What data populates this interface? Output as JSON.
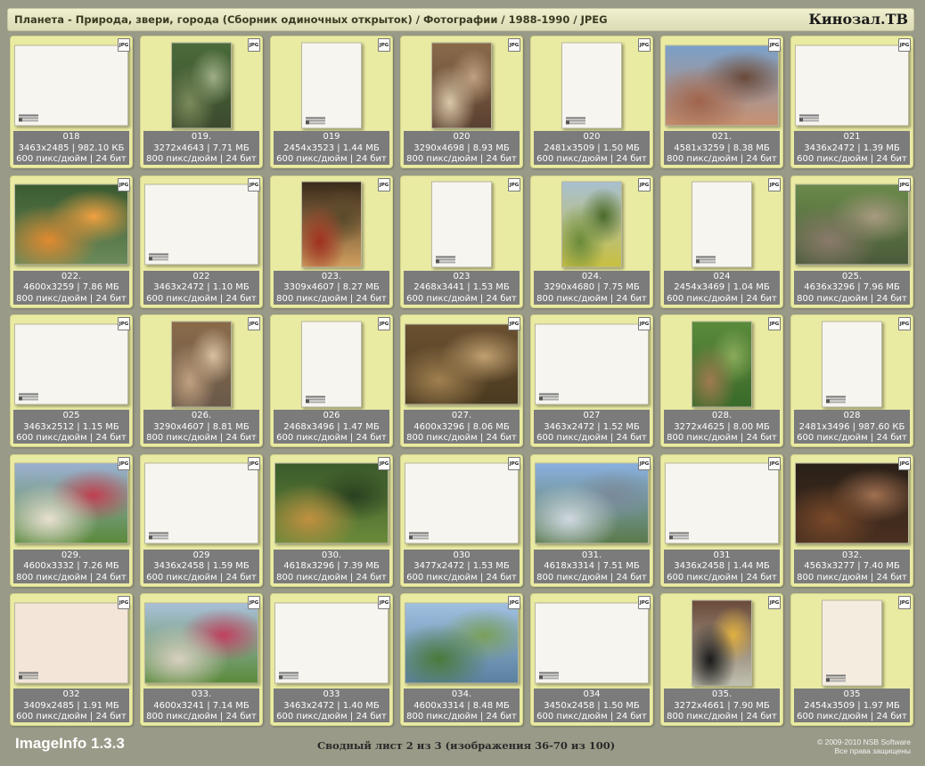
{
  "header": {
    "title": "Планета - Природа, звери, города (Сборник одиночных открыток) / Фотографии / 1988-1990 / JPEG",
    "brand": "Кинозал.ТВ"
  },
  "badge_label": "JPG",
  "cells": [
    {
      "name": "018",
      "dims": "3463x2485 | 982.10 КБ",
      "meta": "600 пикс/дюйм | 24 бит",
      "kind": "back-land"
    },
    {
      "name": "019.",
      "dims": "3272x4643 | 7.71 МБ",
      "meta": "800 пикс/дюйм | 24 бит",
      "kind": "photo-port",
      "palette": [
        "#4a6b3a",
        "#7a8a5a",
        "#3c4a2e",
        "#9fae86"
      ]
    },
    {
      "name": "019",
      "dims": "2454x3523 | 1.44 МБ",
      "meta": "600 пикс/дюйм | 24 бит",
      "kind": "back-port"
    },
    {
      "name": "020",
      "dims": "3290x4698 | 8.93 МБ",
      "meta": "800 пикс/дюйм | 24 бит",
      "kind": "photo-port",
      "palette": [
        "#8a6a4a",
        "#d9c7a8",
        "#5a4030",
        "#c0a080"
      ]
    },
    {
      "name": "020",
      "dims": "2481x3509 | 1.50 МБ",
      "meta": "600 пикс/дюйм | 24 бит",
      "kind": "back-port"
    },
    {
      "name": "021.",
      "dims": "4581x3259 | 8.38 МБ",
      "meta": "800 пикс/дюйм | 24 бит",
      "kind": "photo-land",
      "palette": [
        "#7aa0c8",
        "#a0644a",
        "#c89070",
        "#6a4a3a"
      ]
    },
    {
      "name": "021",
      "dims": "3436x2472 | 1.39 МБ",
      "meta": "600 пикс/дюйм | 24 бит",
      "kind": "back-land"
    },
    {
      "name": "022.",
      "dims": "4600x3259 | 7.86 МБ",
      "meta": "800 пикс/дюйм | 24 бит",
      "kind": "photo-land",
      "palette": [
        "#3a5a30",
        "#e08a30",
        "#6a8a5a",
        "#f0a040"
      ]
    },
    {
      "name": "022",
      "dims": "3463x2472 | 1.10 МБ",
      "meta": "600 пикс/дюйм | 24 бит",
      "kind": "back-land"
    },
    {
      "name": "023.",
      "dims": "3309x4607 | 8.27 МБ",
      "meta": "800 пикс/дюйм | 24 бит",
      "kind": "photo-port",
      "palette": [
        "#3a2a1a",
        "#a03020",
        "#d0a060",
        "#5a4a2a"
      ]
    },
    {
      "name": "023",
      "dims": "2468x3441 | 1.53 МБ",
      "meta": "600 пикс/дюйм | 24 бит",
      "kind": "back-port"
    },
    {
      "name": "024.",
      "dims": "3290x4680 | 7.75 МБ",
      "meta": "800 пикс/дюйм | 24 бит",
      "kind": "photo-port",
      "palette": [
        "#a8c0d0",
        "#6a8a3a",
        "#c8c040",
        "#4a6a2a"
      ]
    },
    {
      "name": "024",
      "dims": "2454x3469 | 1.04 МБ",
      "meta": "600 пикс/дюйм | 24 бит",
      "kind": "back-port"
    },
    {
      "name": "025.",
      "dims": "4636x3296 | 7.96 МБ",
      "meta": "800 пикс/дюйм | 24 бит",
      "kind": "photo-land",
      "palette": [
        "#6a8a4a",
        "#8a7a6a",
        "#4a5a3a",
        "#a89a80"
      ]
    },
    {
      "name": "025",
      "dims": "3463x2512 | 1.15 МБ",
      "meta": "600 пикс/дюйм | 24 бит",
      "kind": "back-land"
    },
    {
      "name": "026.",
      "dims": "3290x4607 | 8.81 МБ",
      "meta": "800 пикс/дюйм | 24 бит",
      "kind": "photo-port",
      "palette": [
        "#8a6a4a",
        "#c0a080",
        "#6a5a4a",
        "#d8c0a0"
      ]
    },
    {
      "name": "026",
      "dims": "2468x3496 | 1.47 МБ",
      "meta": "600 пикс/дюйм | 24 бит",
      "kind": "back-port"
    },
    {
      "name": "027.",
      "dims": "4600x3296 | 8.06 МБ",
      "meta": "800 пикс/дюйм | 24 бит",
      "kind": "photo-land",
      "palette": [
        "#6a5030",
        "#a08050",
        "#4a3a20",
        "#c0a070"
      ]
    },
    {
      "name": "027",
      "dims": "3463x2472 | 1.52 МБ",
      "meta": "600 пикс/дюйм | 24 бит",
      "kind": "back-land"
    },
    {
      "name": "028.",
      "dims": "3272x4625 | 8.00 МБ",
      "meta": "800 пикс/дюйм | 24 бит",
      "kind": "photo-port",
      "palette": [
        "#5a8a3a",
        "#a07a50",
        "#3a6a2a",
        "#8aaa5a"
      ]
    },
    {
      "name": "028",
      "dims": "2481x3496 | 987.60 КБ",
      "meta": "600 пикс/дюйм | 24 бит",
      "kind": "back-port"
    },
    {
      "name": "029.",
      "dims": "4600x3332 | 7.26 МБ",
      "meta": "800 пикс/дюйм | 24 бит",
      "kind": "photo-land",
      "palette": [
        "#9ab0d0",
        "#e8e0d0",
        "#5a8a3a",
        "#c04050"
      ]
    },
    {
      "name": "029",
      "dims": "3436x2458 | 1.59 МБ",
      "meta": "600 пикс/дюйм | 24 бит",
      "kind": "back-land"
    },
    {
      "name": "030.",
      "dims": "4618x3296 | 7.39 МБ",
      "meta": "800 пикс/дюйм | 24 бит",
      "kind": "photo-land",
      "palette": [
        "#3a5a2a",
        "#c09040",
        "#6a8a3a",
        "#2a4020"
      ]
    },
    {
      "name": "030",
      "dims": "3477x2472 | 1.53 МБ",
      "meta": "600 пикс/дюйм | 24 бит",
      "kind": "back-land"
    },
    {
      "name": "031.",
      "dims": "4618x3314 | 7.51 МБ",
      "meta": "800 пикс/дюйм | 24 бит",
      "kind": "photo-land",
      "palette": [
        "#8ab0e0",
        "#d0d8e0",
        "#5a7a4a",
        "#7a8a9a"
      ]
    },
    {
      "name": "031",
      "dims": "3436x2458 | 1.44 МБ",
      "meta": "600 пикс/дюйм | 24 бит",
      "kind": "back-land"
    },
    {
      "name": "032.",
      "dims": "4563x3277 | 7.40 МБ",
      "meta": "800 пикс/дюйм | 24 бит",
      "kind": "photo-land",
      "palette": [
        "#2a2018",
        "#7a4a2a",
        "#4a3020",
        "#a07050"
      ]
    },
    {
      "name": "032",
      "dims": "3409x2485 | 1.91 МБ",
      "meta": "600 пикс/дюйм | 24 бит",
      "kind": "back-land-tint"
    },
    {
      "name": "033.",
      "dims": "4600x3241 | 7.14 МБ",
      "meta": "800 пикс/дюйм | 24 бит",
      "kind": "photo-land",
      "palette": [
        "#a8c0d8",
        "#d8d0c0",
        "#5a8a3a",
        "#c04060"
      ]
    },
    {
      "name": "033",
      "dims": "3463x2472 | 1.40 МБ",
      "meta": "600 пикс/дюйм | 24 бит",
      "kind": "back-land"
    },
    {
      "name": "034.",
      "dims": "4600x3314 | 8.48 МБ",
      "meta": "800 пикс/дюйм | 24 бит",
      "kind": "photo-land",
      "palette": [
        "#a0c0e0",
        "#4a7a3a",
        "#5a80a0",
        "#7aa05a"
      ]
    },
    {
      "name": "034",
      "dims": "3450x2458 | 1.50 МБ",
      "meta": "600 пикс/дюйм | 24 бит",
      "kind": "back-land"
    },
    {
      "name": "035.",
      "dims": "3272x4661 | 7.90 МБ",
      "meta": "800 пикс/дюйм | 24 бит",
      "kind": "photo-port",
      "palette": [
        "#6a4a3a",
        "#1a1a1a",
        "#c0c0b0",
        "#e0b040"
      ]
    },
    {
      "name": "035",
      "dims": "2454x3509 | 1.97 МБ",
      "meta": "600 пикс/дюйм | 24 бит",
      "kind": "back-port-tint"
    }
  ],
  "footer": {
    "app_name": "ImageInfo 1.3.3",
    "sheet_info": "Сводный лист 2 из 3 (изображения 36-70 из 100)",
    "copyright_line1": "© 2009-2010 NSB Software",
    "copyright_line2": "Все права защищены"
  }
}
